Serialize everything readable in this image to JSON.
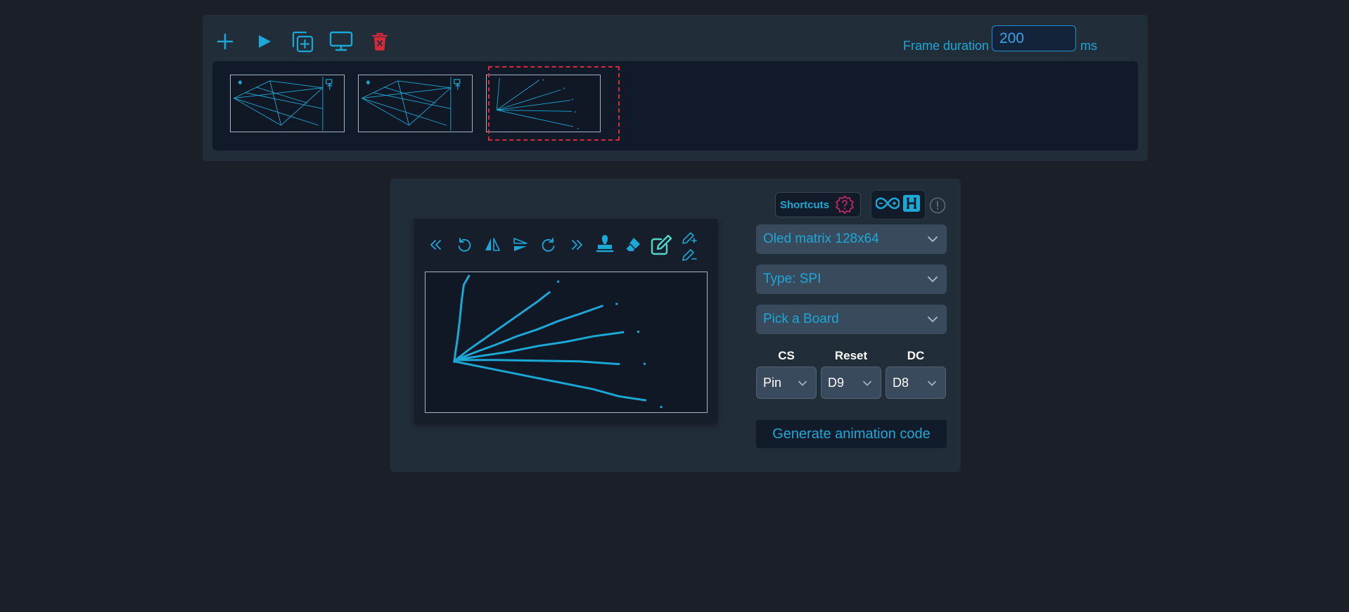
{
  "toolbar": {
    "icons": [
      "plus-icon",
      "play-icon",
      "duplicate-icon",
      "monitor-icon",
      "trash-icon"
    ],
    "frame_duration_label": "Frame duration",
    "frame_duration_value": "200",
    "frame_duration_unit": "ms"
  },
  "frames": {
    "count": 3,
    "selected_index": 2
  },
  "editor": {
    "tools": [
      "chevrons-left-icon",
      "rotate-left-icon",
      "flip-horizontal-icon",
      "flip-vertical-icon",
      "rotate-right-icon",
      "chevrons-right-icon",
      "stamp-icon",
      "eraser-icon",
      "pencil-icon",
      "pen-plus-icon",
      "pen-minus-icon"
    ],
    "active_tool": "pencil-icon"
  },
  "settings": {
    "shortcuts_label": "Shortcuts",
    "display_select": "Oled matrix 128x64",
    "type_select": "Type: SPI",
    "board_select": "Pick a Board",
    "pins": [
      {
        "label": "CS",
        "value": "Pin"
      },
      {
        "label": "Reset",
        "value": "D9"
      },
      {
        "label": "DC",
        "value": "D8"
      }
    ],
    "generate_label": "Generate animation code"
  },
  "colors": {
    "accent": "#1ba8d6",
    "danger": "#d8283a",
    "background": "#1b1f28",
    "panel": "#222d3a"
  }
}
